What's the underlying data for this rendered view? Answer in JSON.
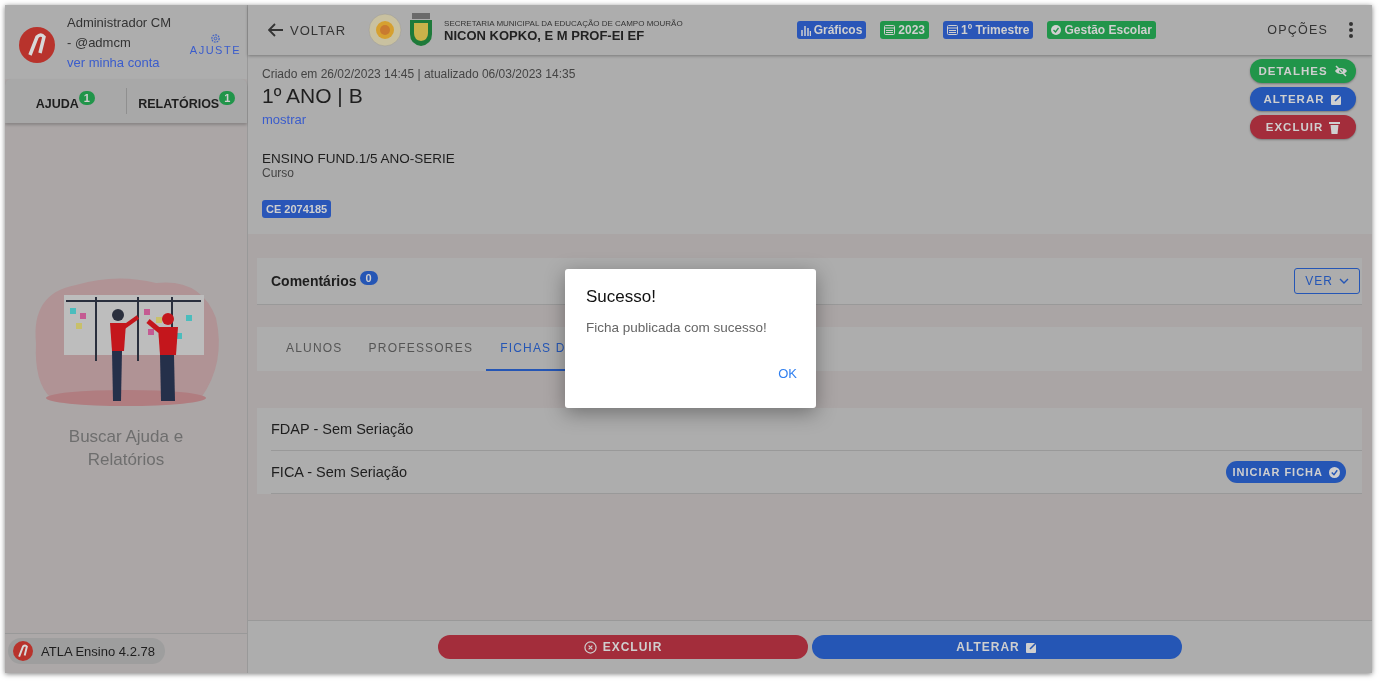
{
  "user": {
    "name": "Administrador CM",
    "handle": "- @admcm",
    "account_link": "ver minha conta",
    "settings": "AJUSTE"
  },
  "sidebar_tabs": [
    {
      "label": "AJUDA",
      "badge": "1"
    },
    {
      "label": "RELATÓRIOS",
      "badge": "1"
    }
  ],
  "help_panel": {
    "text": "Buscar Ajuda e Relatórios"
  },
  "version": "ATLA Ensino 4.2.78",
  "header": {
    "back": "VOLTAR",
    "org": "SECRETARIA MUNICIPAL DA EDUCAÇÃO DE CAMPO MOURÃO",
    "school": "NICON KOPKO, E M PROF-EI EF",
    "options": "OPÇÕES",
    "tags": [
      {
        "label": "Gráficos",
        "color": "#2a56b8",
        "kind": "chart"
      },
      {
        "label": "2023",
        "color": "#21954a",
        "kind": "calendar"
      },
      {
        "label": "1º Trimestre",
        "color": "#2a56b8",
        "kind": "calendar"
      },
      {
        "label": "Gestão Escolar",
        "color": "#21954a",
        "kind": "check"
      }
    ]
  },
  "record": {
    "meta": "Criado em 26/02/2023 14:45 | atualizado 06/03/2023 14:35",
    "title": "1º ANO | B",
    "show_link": "mostrar",
    "course": "ENSINO FUND.1/5 ANO-SERIE",
    "course_label": "Curso",
    "code": "CE 2074185"
  },
  "actions": [
    {
      "label": "DETALHES",
      "kind": "details"
    },
    {
      "label": "ALTERAR",
      "kind": "edit"
    },
    {
      "label": "EXCLUIR",
      "kind": "delete"
    }
  ],
  "comments": {
    "title": "Comentários",
    "count": "0",
    "button": "VER"
  },
  "tabs": [
    {
      "label": "ALUNOS",
      "selected": false
    },
    {
      "label": "PROFESSORES",
      "selected": false
    },
    {
      "label": "FICHAS D",
      "selected": true
    }
  ],
  "forms": [
    {
      "name": "FDAP - Sem Seriação"
    },
    {
      "name": "FICA - Sem Seriação",
      "action": "INICIAR FICHA"
    }
  ],
  "footer_buttons": [
    {
      "label": "EXCLUIR",
      "kind": "delete"
    },
    {
      "label": "ALTERAR",
      "kind": "edit"
    }
  ],
  "dialog": {
    "title": "Sucesso!",
    "message": "Ficha publicada com sucesso!",
    "button": "OK"
  }
}
